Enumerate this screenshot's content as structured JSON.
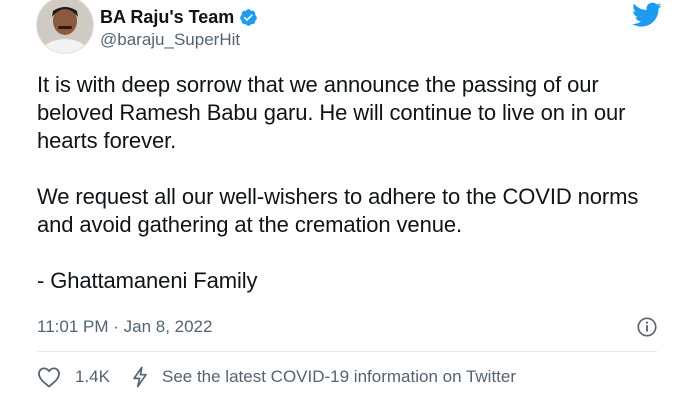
{
  "user": {
    "display_name": "BA Raju's Team",
    "handle": "@baraju_SuperHit",
    "verified": true
  },
  "tweet": {
    "paragraphs": [
      "It is with deep sorrow that we announce the passing of our beloved Ramesh Babu garu. He will continue to live on in our hearts forever.",
      "We request all our well-wishers to adhere to the COVID norms and avoid gathering at the cremation venue.",
      "- Ghattamaneni Family"
    ],
    "timestamp": "11:01 PM · Jan 8, 2022"
  },
  "actions": {
    "like_count": "1.4K",
    "covid_info": "See the latest COVID-19 information on Twitter"
  },
  "icons": {
    "verified": "verified-badge-icon",
    "logo": "twitter-bird-icon",
    "info": "info-circle-icon",
    "like": "heart-icon",
    "covid": "lightning-bolt-icon"
  },
  "colors": {
    "brand": "#1d9bf0",
    "text": "#0f1419",
    "secondary": "#536471"
  }
}
